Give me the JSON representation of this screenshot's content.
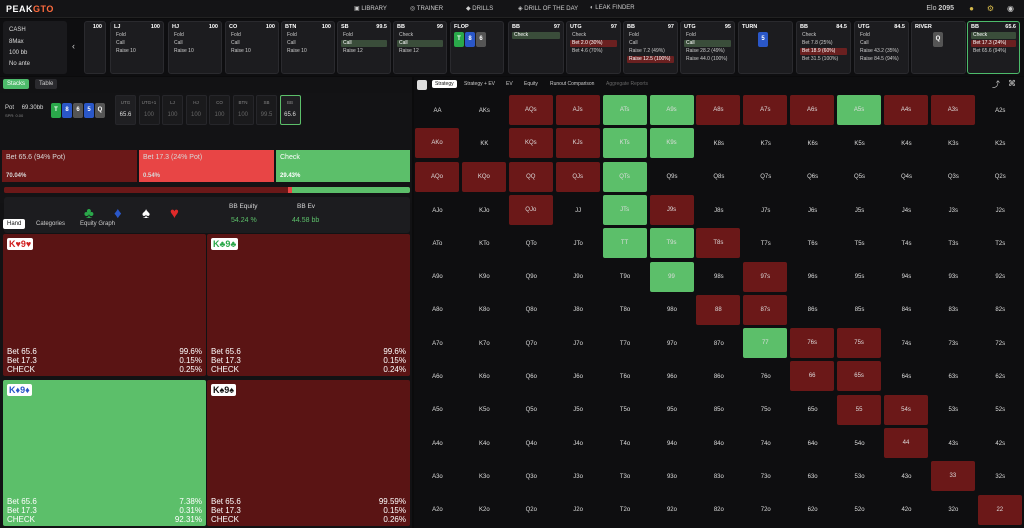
{
  "app": {
    "logo_a": "PEAK",
    "logo_b": "GTO",
    "nav": [
      "LIBRARY",
      "TRAINER",
      "DRILLS",
      "DRILL OF THE DAY",
      "LEAK FINDER"
    ],
    "elo_label": "Elo",
    "elo_value": "2095"
  },
  "game": {
    "type": "CASH",
    "format": "8Max",
    "stack": "100 bb",
    "ante": "No ante"
  },
  "positions": [
    {
      "pos": "LJ",
      "stack": "100",
      "actions": [
        "Fold",
        "Call",
        "Raise 10"
      ]
    },
    {
      "pos": "HJ",
      "stack": "100",
      "actions": [
        "Fold",
        "Call",
        "Raise 10"
      ]
    },
    {
      "pos": "CO",
      "stack": "100",
      "actions": [
        "Fold",
        "Call",
        "Raise 10"
      ]
    },
    {
      "pos": "BTN",
      "stack": "100",
      "actions": [
        "Fold",
        "Call",
        "Raise 10"
      ]
    },
    {
      "pos": "SB",
      "stack": "99.5",
      "actions": [
        "Fold",
        "Call",
        "Raise 12"
      ]
    },
    {
      "pos": "BB",
      "stack": "99",
      "actions": [
        "Check",
        "Call",
        "Raise 12"
      ]
    },
    {
      "pos": "FLOP",
      "stack": "",
      "actions": []
    },
    {
      "pos": "BB",
      "stack": "97",
      "actions": [
        "Check"
      ]
    },
    {
      "pos": "UTG",
      "stack": "97",
      "actions": [
        "Check",
        "Bet 2.0 (30%)",
        "Bet 4.6 (70%)"
      ]
    },
    {
      "pos": "BB",
      "stack": "97",
      "actions": [
        "Fold",
        "Call",
        "Raise 7.2 (49%)",
        "Raise 12.5 (100%)"
      ]
    },
    {
      "pos": "UTG",
      "stack": "95",
      "actions": [
        "Fold",
        "Call",
        "Raise 28.2 (49%)",
        "Raise 44.0 (100%)"
      ]
    },
    {
      "pos": "TURN",
      "stack": "",
      "actions": []
    },
    {
      "pos": "BB",
      "stack": "84.5",
      "actions": [
        "Check",
        "Bet 7.8 (25%)",
        "Bet 18.9 (60%)",
        "Bet 31.5 (100%)"
      ]
    },
    {
      "pos": "UTG",
      "stack": "84.5",
      "actions": [
        "Fold",
        "Call",
        "Raise 43.2 (35%)",
        "Raise 84.5 (94%)"
      ]
    },
    {
      "pos": "RIVER",
      "stack": "",
      "actions": []
    },
    {
      "pos": "BB",
      "stack": "65.6",
      "actions": [
        "Check",
        "Bet 17.3 (24%)",
        "Bet 65.6 (94%)"
      ]
    }
  ],
  "board": {
    "flop": [
      "T",
      "8",
      "6"
    ],
    "turn": "5",
    "river": "Q"
  },
  "left": {
    "tabs": [
      "Stacks",
      "Table"
    ],
    "pot_label": "Pot",
    "pot_value": "69.30bb",
    "spr": "SPR: 0.00",
    "seats": [
      {
        "p": "UTG",
        "s": "65.6"
      },
      {
        "p": "UTG+1",
        "s": "100"
      },
      {
        "p": "LJ",
        "s": "100"
      },
      {
        "p": "HJ",
        "s": "100"
      },
      {
        "p": "CO",
        "s": "100"
      },
      {
        "p": "BTN",
        "s": "100"
      },
      {
        "p": "SB",
        "s": "99.5"
      },
      {
        "p": "BB",
        "s": "65.6"
      }
    ],
    "actions": [
      {
        "label": "Bet 65.6 (94% Pot)",
        "pct": "70.04%"
      },
      {
        "label": "Bet 17.3 (24% Pot)",
        "pct": "0.54%"
      },
      {
        "label": "Check",
        "pct": "29.43%"
      }
    ],
    "equity_label": "BB Equity",
    "equity_value": "54.24 %",
    "ev_label": "BB Ev",
    "ev_value": "44.58 bb",
    "hand_tabs": [
      "Hand",
      "Categories",
      "Equity Graph"
    ],
    "hands": [
      {
        "rank1": "K",
        "suit1": "♥",
        "rank2": "9",
        "suit2": "♥",
        "rows": [
          [
            "Bet 65.6",
            "99.6%"
          ],
          [
            "Bet 17.3",
            "0.15%"
          ],
          [
            "CHECK",
            "0.25%"
          ]
        ]
      },
      {
        "rank1": "K",
        "suit1": "♣",
        "rank2": "9",
        "suit2": "♣",
        "rows": [
          [
            "Bet 65.6",
            "99.6%"
          ],
          [
            "Bet 17.3",
            "0.15%"
          ],
          [
            "CHECK",
            "0.24%"
          ]
        ]
      },
      {
        "rank1": "K",
        "suit1": "♦",
        "rank2": "9",
        "suit2": "♦",
        "rows": [
          [
            "Bet 65.6",
            "7.38%"
          ],
          [
            "Bet 17.3",
            "0.31%"
          ],
          [
            "CHECK",
            "92.31%"
          ]
        ]
      },
      {
        "rank1": "K",
        "suit1": "♠",
        "rank2": "9",
        "suit2": "♠",
        "rows": [
          [
            "Bet 65.6",
            "99.59%"
          ],
          [
            "Bet 17.3",
            "0.15%"
          ],
          [
            "CHECK",
            "0.26%"
          ]
        ]
      }
    ]
  },
  "right": {
    "tabs": [
      "Strategy",
      "Strategy + EV",
      "EV",
      "Equity",
      "Runout Comparison",
      "Aggregate Reports"
    ],
    "ranks": [
      "A",
      "K",
      "Q",
      "J",
      "T",
      "9",
      "8",
      "7",
      "6",
      "5",
      "4",
      "3",
      "2"
    ],
    "cells": {
      "AQs": "r",
      "AJs": "r",
      "ATs": "g",
      "A9s": "g",
      "A8s": "r",
      "A7s": "r",
      "A6s": "r",
      "A5s": "g",
      "A4s": "r",
      "A3s": "r",
      "AKo": "r",
      "KQs": "r",
      "KJs": "r",
      "KTs": "g",
      "K9s": "g",
      "AQo": "r",
      "KQo": "r",
      "QQ": "r",
      "QJs": "r",
      "QTs": "g",
      "QJo": "r",
      "JTs": "g",
      "J9s": "r",
      "TT": "g",
      "T9s": "g",
      "T8s": "r",
      "99": "g",
      "97s": "r",
      "88": "r",
      "87s": "r",
      "77": "g",
      "76s": "r",
      "75s": "r",
      "66": "r",
      "65s": "r",
      "55": "r",
      "54s": "r",
      "44": "r",
      "33": "r",
      "22": "r"
    }
  },
  "colors": {
    "green": "#5cbf6a",
    "red": "#6b1818",
    "bright_red": "#e84545",
    "dark": "#0e0e10"
  }
}
